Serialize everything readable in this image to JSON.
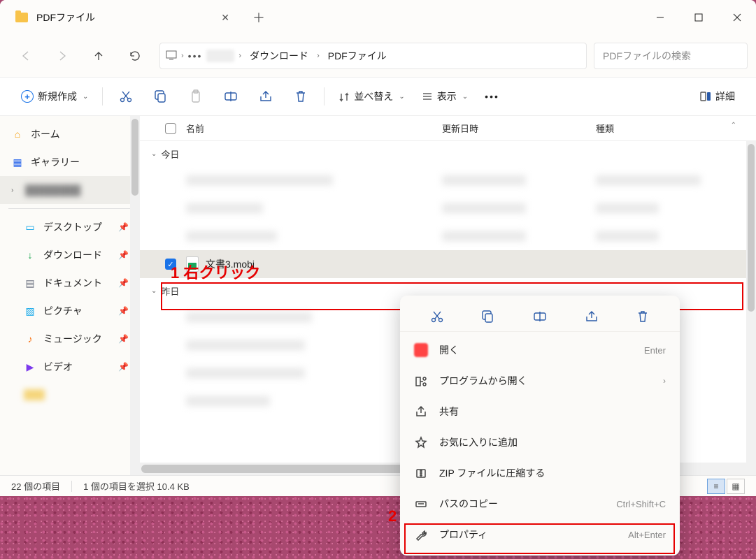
{
  "titlebar": {
    "tab_title": "PDFファイル"
  },
  "breadcrumb": {
    "item1": "ダウンロード",
    "item2": "PDFファイル"
  },
  "search": {
    "placeholder": "PDFファイルの検索"
  },
  "toolbar": {
    "new": "新規作成",
    "sort": "並べ替え",
    "view": "表示",
    "details": "詳細"
  },
  "sidebar": {
    "home": "ホーム",
    "gallery": "ギャラリー",
    "desktop": "デスクトップ",
    "download": "ダウンロード",
    "document": "ドキュメント",
    "picture": "ピクチャ",
    "music": "ミュージック",
    "video": "ビデオ"
  },
  "columns": {
    "name": "名前",
    "date": "更新日時",
    "type": "種類"
  },
  "groups": {
    "today": "今日",
    "yesterday": "昨日"
  },
  "selected_file": {
    "name": "文書3.mobi"
  },
  "annotation": {
    "step1_num": "1",
    "step1_text": "右クリック",
    "step2_num": "2"
  },
  "context_menu": {
    "open": "開く",
    "open_shortcut": "Enter",
    "open_with": "プログラムから開く",
    "share": "共有",
    "favorite": "お気に入りに追加",
    "zip": "ZIP ファイルに圧縮する",
    "copy_path": "パスのコピー",
    "copy_path_shortcut": "Ctrl+Shift+C",
    "properties": "プロパティ",
    "properties_shortcut": "Alt+Enter"
  },
  "status": {
    "items": "22 個の項目",
    "selected": "1 個の項目を選択 10.4 KB"
  }
}
